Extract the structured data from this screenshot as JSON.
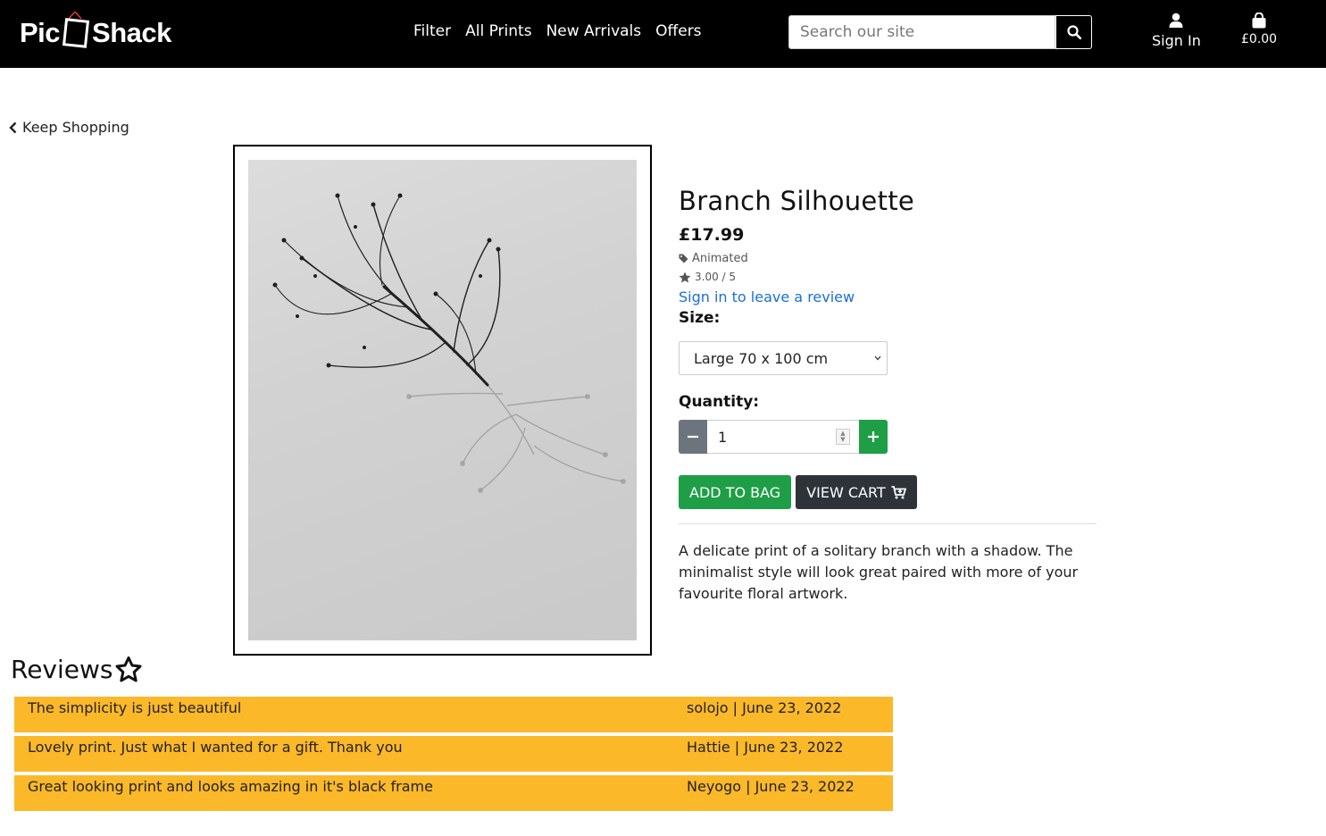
{
  "header": {
    "logo_left": "Pic",
    "logo_right": "Shack",
    "nav": [
      "Filter",
      "All Prints",
      "New Arrivals",
      "Offers"
    ],
    "search_placeholder": "Search our site",
    "signin_label": "Sign In",
    "cart_total": "£0.00"
  },
  "back_link": "Keep Shopping",
  "product": {
    "title": "Branch Silhouette",
    "price": "£17.99",
    "category": "Animated",
    "rating": "3.00 / 5",
    "review_link": "Sign in to leave a review",
    "size_label": "Size:",
    "size_value": "Large 70 x 100 cm",
    "quantity_label": "Quantity:",
    "quantity_value": "1",
    "add_button": "ADD TO BAG",
    "view_button": "VIEW CART",
    "description": "A delicate print of a solitary branch with a shadow. The minimalist style will look great paired with more of your favourite floral artwork."
  },
  "reviews": {
    "title": "Reviews",
    "items": [
      {
        "text": "The simplicity is just beautiful",
        "byline": "solojo | June 23, 2022"
      },
      {
        "text": "Lovely print. Just what I wanted for a gift. Thank you",
        "byline": "Hattie | June 23, 2022"
      },
      {
        "text": "Great looking print and looks amazing in it's black frame",
        "byline": "Neyogo | June 23, 2022"
      }
    ]
  },
  "colors": {
    "header_bg": "#000000",
    "success": "#1e9e46",
    "review_bg": "#fbb829",
    "link": "#1a6fd6",
    "dark_button": "#2d3339"
  }
}
